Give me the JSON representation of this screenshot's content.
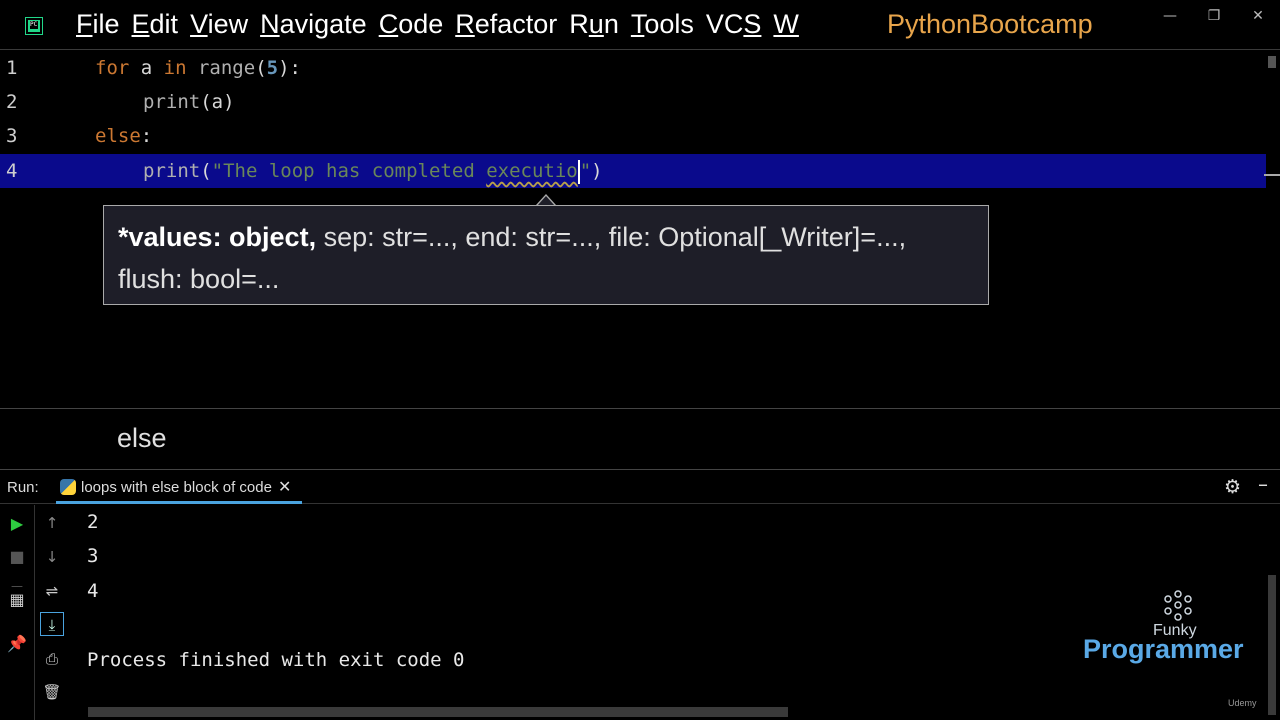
{
  "menu": {
    "items": [
      {
        "mnemonic": "F",
        "rest": "ile"
      },
      {
        "mnemonic": "E",
        "rest": "dit"
      },
      {
        "mnemonic": "V",
        "rest": "iew"
      },
      {
        "mnemonic": "N",
        "rest": "avigate"
      },
      {
        "mnemonic": "C",
        "rest": "ode"
      },
      {
        "mnemonic": "R",
        "rest": "efactor"
      },
      {
        "pre": "R",
        "mnemonic": "u",
        "rest": "n"
      },
      {
        "mnemonic": "T",
        "rest": "ools"
      },
      {
        "pre": "VC",
        "mnemonic": "S",
        "rest": ""
      },
      {
        "mnemonic": "W",
        "rest": ""
      }
    ]
  },
  "project_name": "PythonBootcamp",
  "editor": {
    "lines": [
      {
        "number": "1"
      },
      {
        "number": "2"
      },
      {
        "number": "3"
      },
      {
        "number": "4"
      }
    ],
    "line1": {
      "kw_for": "for",
      "var": " a ",
      "kw_in": "in",
      "fn": " range",
      "open": "(",
      "num": "5",
      "close": "):"
    },
    "line2": {
      "fn": "print",
      "args": "(a)"
    },
    "line3": {
      "kw": "else",
      "colon": ":"
    },
    "line4": {
      "fn": "print",
      "open": "(",
      "str_a": "\"The loop has completed ",
      "str_b": "executio",
      "str_c": "\"",
      "close": ")"
    }
  },
  "tooltip": {
    "bold": "*values: object,",
    "rest": " sep: str=..., end: str=..., file: Optional[_Writer]=...,",
    "line2": "flush: bool=..."
  },
  "breadcrumb": "else",
  "run": {
    "label": "Run:",
    "tab_name": "loops with else  block of code",
    "tab_close": "✕",
    "output": [
      "2",
      "3",
      "4",
      "",
      "Process finished with exit code 0"
    ]
  },
  "watermark": {
    "funky": "Funky",
    "programmer": "Programmer",
    "udemy": "Udemy"
  }
}
